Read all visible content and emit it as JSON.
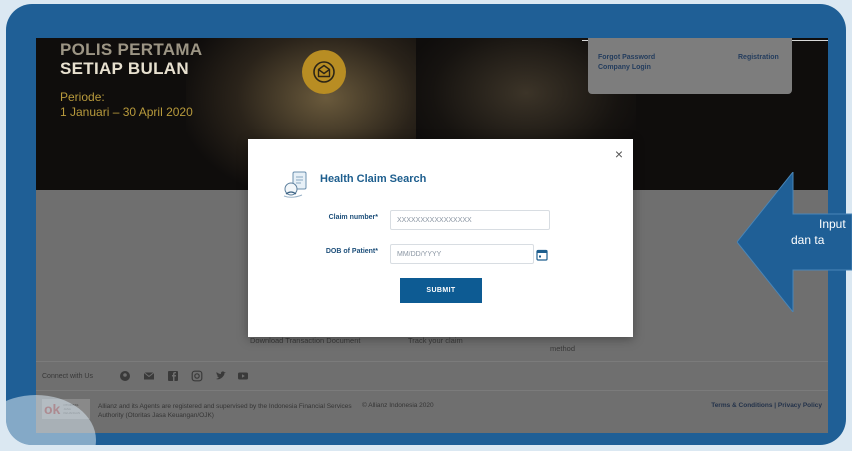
{
  "hero": {
    "title_line1": "POLIS PERTAMA",
    "title_line2": "SETIAP BULAN",
    "period_label": "Periode:",
    "period_value": "1 Januari – 30 April 2020"
  },
  "login_box": {
    "forgot_password": "Forgot Password",
    "company_login": "Company Login",
    "registration": "Registration"
  },
  "features": {
    "download": "Download Transaction Document",
    "track": "Track your claim",
    "method": "method"
  },
  "connect": {
    "label": "Connect with Us",
    "icons": [
      "location-icon",
      "mail-icon",
      "facebook-icon",
      "instagram-icon",
      "twitter-icon",
      "youtube-icon"
    ]
  },
  "footer": {
    "ojk_text": "Allianz and its Agents are registered and supervised by the Indonesia Financial Services Authority (Otoritas Jasa Keuangan/OJK)",
    "copyright": "© Allianz Indonesia 2020",
    "terms": "Terms & Conditions | Privacy Policy"
  },
  "modal": {
    "title": "Health Claim Search",
    "close": "×",
    "claim_label": "Claim number*",
    "claim_placeholder": "XXXXXXXXXXXXXXXX",
    "dob_label": "DOB of Patient*",
    "dob_placeholder": "MM/DD/YYYY",
    "submit_label": "SUBMIT"
  },
  "callout": {
    "line1": "Input",
    "line2": "dan ta"
  },
  "colors": {
    "frame": "#1f5f96",
    "primary_button": "#0d5b93",
    "modal_title": "#1d5e8e",
    "accent_gold": "#b88d23"
  }
}
